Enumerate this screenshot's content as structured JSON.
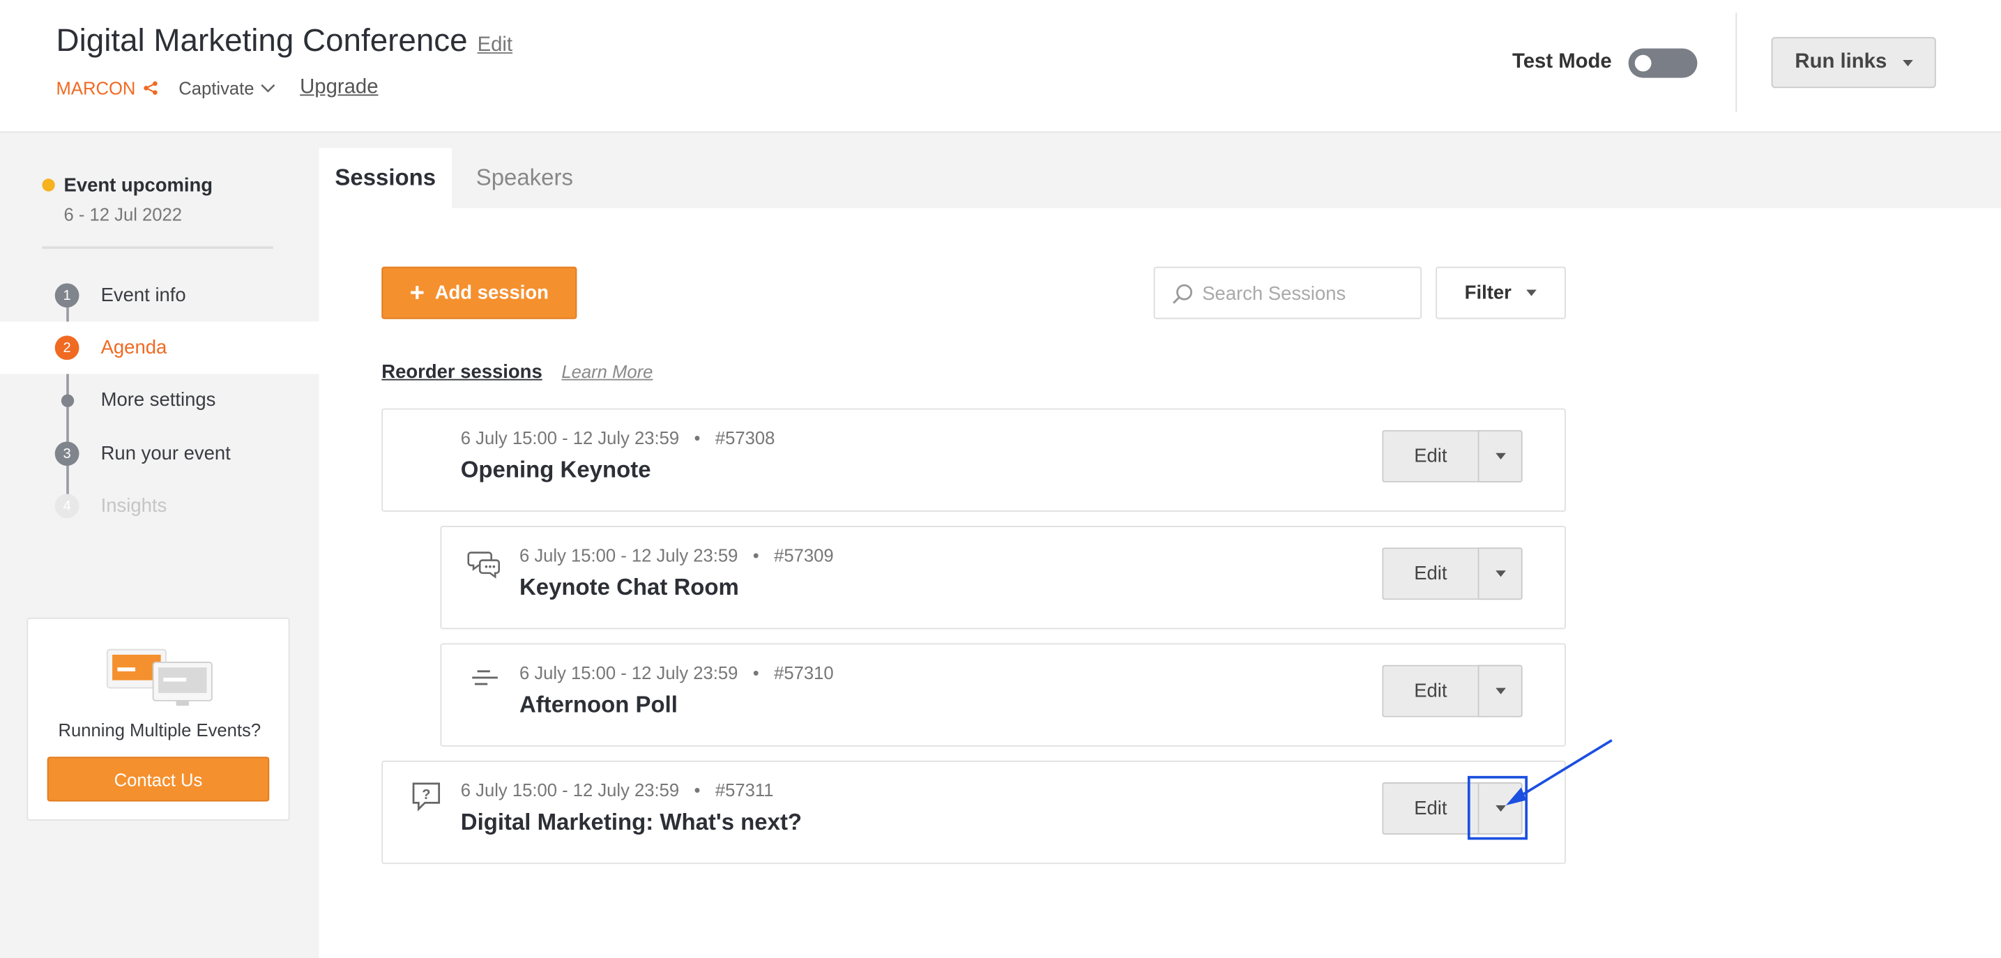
{
  "header": {
    "event_title": "Digital Marketing Conference",
    "edit_label": "Edit",
    "org_name": "MARCON",
    "plan_name": "Captivate",
    "upgrade_label": "Upgrade",
    "test_mode_label": "Test Mode",
    "test_mode_on": false,
    "run_links_label": "Run links"
  },
  "sidebar": {
    "status_text": "Event upcoming",
    "status_dates": "6 - 12 Jul 2022",
    "status_color": "#f6b21f",
    "steps": [
      {
        "number": "1",
        "label": "Event info"
      },
      {
        "number": "2",
        "label": "Agenda",
        "active": true
      },
      {
        "number": "",
        "label": "More settings"
      },
      {
        "number": "3",
        "label": "Run your event"
      },
      {
        "number": "4",
        "label": "Insights",
        "disabled": true
      }
    ],
    "promo": {
      "text": "Running Multiple Events?",
      "button_label": "Contact Us"
    }
  },
  "tabs": [
    {
      "label": "Sessions",
      "active": true
    },
    {
      "label": "Speakers",
      "active": false
    }
  ],
  "toolbar": {
    "add_session_label": "Add session",
    "search_placeholder": "Search Sessions",
    "filter_label": "Filter"
  },
  "reorder": {
    "reorder_label": "Reorder sessions",
    "learn_more_label": "Learn More"
  },
  "sessions": [
    {
      "time": "6 July 15:00 - 12 July 23:59",
      "id": "#57308",
      "name": "Opening Keynote",
      "icon": "none",
      "edit_label": "Edit"
    },
    {
      "time": "6 July 15:00 - 12 July 23:59",
      "id": "#57309",
      "name": "Keynote Chat Room",
      "icon": "chat-icon",
      "edit_label": "Edit"
    },
    {
      "time": "6 July 15:00 - 12 July 23:59",
      "id": "#57310",
      "name": "Afternoon Poll",
      "icon": "poll-icon",
      "edit_label": "Edit"
    },
    {
      "time": "6 July 15:00 - 12 July 23:59",
      "id": "#57311",
      "name": "Digital Marketing: What's next?",
      "icon": "question-icon",
      "edit_label": "Edit"
    }
  ],
  "colors": {
    "accent": "#f06a22",
    "button_orange": "#f5902e",
    "annotation_blue": "#1b4fe0"
  }
}
